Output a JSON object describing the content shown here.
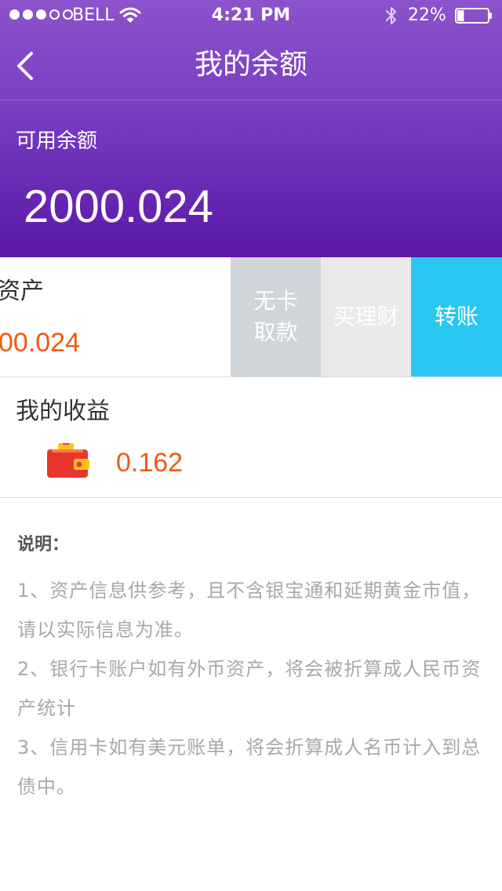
{
  "status_bar": {
    "carrier": "BELL",
    "time": "4:21 PM",
    "battery": "22%",
    "signal_bars_filled": 3,
    "signal_bars_total": 5,
    "battery_level": 0.22
  },
  "nav": {
    "title": "我的余额",
    "back_icon": "chevron-left-icon"
  },
  "balance": {
    "label": "可用余额",
    "value": "2000.024"
  },
  "asset": {
    "label": "资产",
    "value": "00.024"
  },
  "actions": {
    "cardless_withdraw_line1": "无卡",
    "cardless_withdraw_line2": "取款",
    "buy_finance": "买理财",
    "transfer": "转账"
  },
  "earnings": {
    "title": "我的收益",
    "icon": "wallet-icon",
    "value": "0.162"
  },
  "notes": {
    "title": "说明：",
    "items": [
      "1、资产信息供参考，且不含银宝通和延期黄金市值，请以实际信息为准。",
      "2、银行卡账户如有外币资产，将会被折算成人民币资产统计",
      "3、信用卡如有美元账单，将会折算成人名币计入到总债中。"
    ]
  },
  "colors": {
    "header_top": "#8d52cc",
    "header_bottom": "#5a17a8",
    "accent_orange": "#f05a14",
    "transfer_blue": "#2ac6f2",
    "cardless_gray": "#cfd5d8",
    "finance_gray": "#e9e9e9"
  }
}
